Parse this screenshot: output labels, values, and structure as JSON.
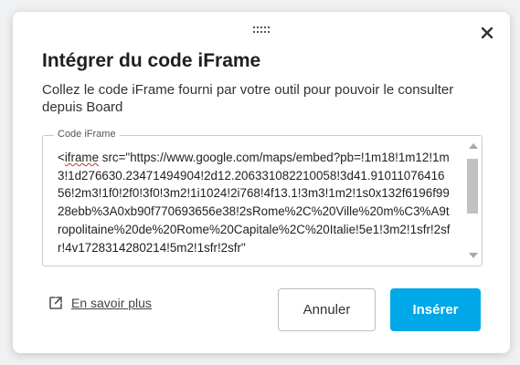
{
  "dialog": {
    "title": "Intégrer du code iFrame",
    "description": "Collez le code iFrame fourni par votre outil pour pouvoir le consulter depuis Board",
    "close_icon": "close-icon",
    "drag_icon": "drag-handle-icon"
  },
  "code_field": {
    "label": "Code iFrame",
    "value_start": "<",
    "value_tag": "iframe",
    "value_rest": " src=\"https://www.google.com/maps/embed?pb=!1m18!1m12!1m3!1d276630.23471494904!2d12.206331082210058!3d41.9101107641656!2m3!1f0!2f0!3f0!3m2!1i1024!2i768!4f13.1!3m3!1m2!1s0x132f6196f9928ebb%3A0xb90f770693656e38!2sRome%2C%20Ville%20m%C3%A9tropolitaine%20de%20Rome%20Capitale%2C%20Italie!5e1!3m2!1sfr!2sfr!4v1728314280214!5m2!1sfr!2sfr\""
  },
  "footer": {
    "learn_more_label": "En savoir plus",
    "learn_more_icon": "external-link-icon",
    "cancel_label": "Annuler",
    "insert_label": "Insérer"
  },
  "colors": {
    "primary": "#00a8e8",
    "background": "#f0f1f3",
    "text": "#1f1f1f"
  }
}
